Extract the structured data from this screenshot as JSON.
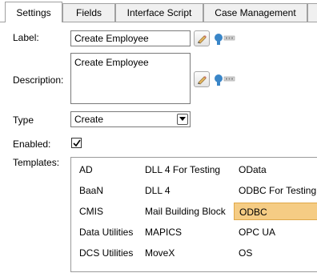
{
  "tabs": [
    {
      "label": "Settings",
      "active": true
    },
    {
      "label": "Fields",
      "active": false
    },
    {
      "label": "Interface Script",
      "active": false
    },
    {
      "label": "Case Management",
      "active": false
    }
  ],
  "form": {
    "label_caption": "Label:",
    "label_value": "Create Employee",
    "description_caption": "Description:",
    "description_value": "Create Employee",
    "type_caption": "Type",
    "type_value": "Create",
    "enabled_caption": "Enabled:",
    "enabled_checked": true,
    "templates_caption": "Templates:"
  },
  "templates": {
    "columns": [
      [
        "AD",
        "BaaN",
        "CMIS",
        "Data Utilities",
        "DCS Utilities"
      ],
      [
        "DLL 4 For Testing",
        "DLL 4",
        "Mail Building Block",
        "MAPICS",
        "MoveX"
      ],
      [
        "OData",
        "ODBC For Testing",
        "ODBC",
        "OPC UA",
        "OS"
      ]
    ],
    "selected": "ODBC"
  },
  "icons": {
    "edit": "edit-pencil-icon",
    "translate": "translate-key-icon",
    "dropdown": "chevron-down-icon",
    "check": "checkmark-icon"
  },
  "colors": {
    "selection": "#f5cc84",
    "selection_border": "#e0a848",
    "tab_border": "#a0a0a0"
  }
}
